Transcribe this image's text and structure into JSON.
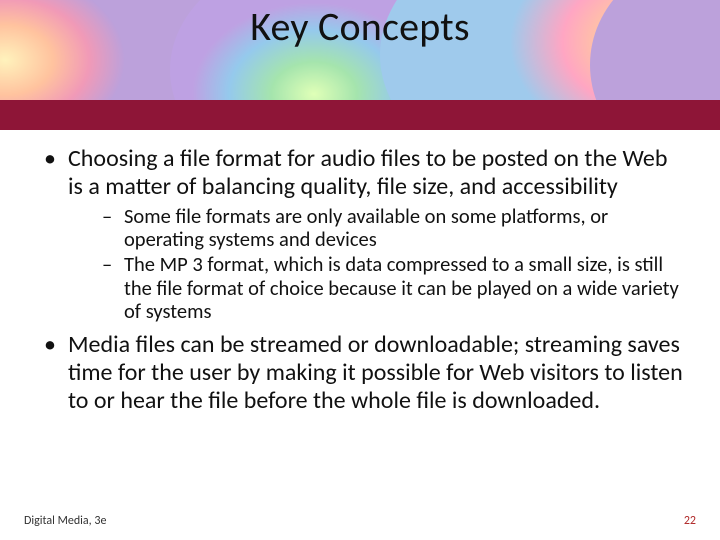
{
  "title": "Key Concepts",
  "bullets": {
    "b1": "Choosing a file format for audio files to be posted on the Web is a matter of balancing quality, file size, and accessibility",
    "b1_subs": {
      "s1": "Some file formats are only available on some platforms, or operating systems and devices",
      "s2": "The MP 3 format, which is data compressed to a small size, is still the file format of choice because it can be played on a wide variety of systems"
    },
    "b2": "Media files can be streamed or downloadable; streaming saves time for the user by making it possible for Web visitors to listen to or hear the file before the whole file is downloaded."
  },
  "footer": {
    "left": "Digital Media, 3e",
    "page": "22"
  },
  "colors": {
    "accent": "#8e1537"
  }
}
